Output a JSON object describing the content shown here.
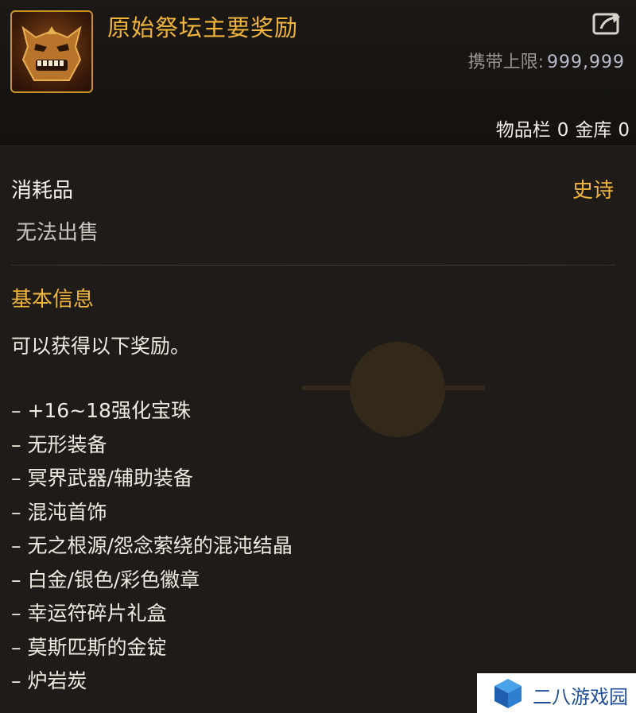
{
  "item": {
    "title": "原始祭坛主要奖励",
    "icon": "demon-mask-icon",
    "carry_limit_label": "携带上限:",
    "carry_limit_value": "999,999",
    "inventory_label": "物品栏",
    "inventory_count": "0",
    "vault_label": "金库",
    "vault_count": "0",
    "category": "消耗品",
    "rarity": "史诗",
    "sale_status": "无法出售"
  },
  "info": {
    "section_title": "基本信息",
    "description": "可以获得以下奖励。",
    "rewards": [
      "– +16~18强化宝珠",
      "– 无形装备",
      "– 冥界武器/辅助装备",
      "– 混沌首饰",
      "– 无之根源/怨念萦绕的混沌结晶",
      "– 白金/银色/彩色徽章",
      "– 幸运符碎片礼盒",
      "– 莫斯匹斯的金锭",
      "– 炉岩炭"
    ]
  },
  "watermark": {
    "text": "二八游戏园",
    "icon": "cube-logo-icon"
  },
  "colors": {
    "gold": "#f0b53a",
    "text": "#efe9e0",
    "background": "#1e1b18"
  }
}
